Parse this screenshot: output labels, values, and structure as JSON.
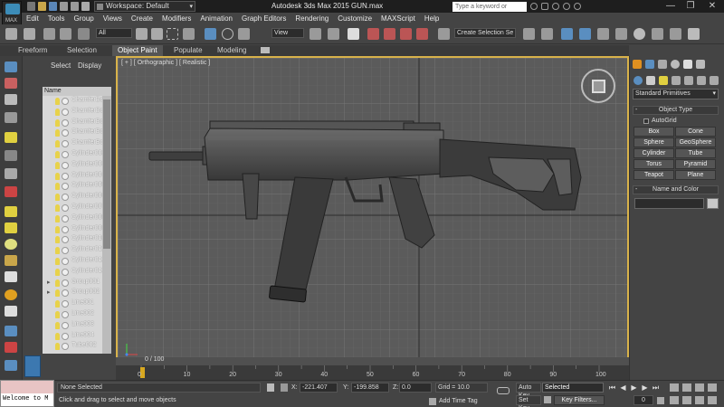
{
  "app": {
    "title": "Autodesk 3ds Max  2015    GUN.max",
    "workspace": "Workspace: Default",
    "logo_text": "MAX",
    "search_placeholder": "Type a keyword or phrase"
  },
  "window_controls": {
    "minimize": "—",
    "maximize": "❐",
    "close": "✕"
  },
  "menu": [
    "Edit",
    "Tools",
    "Group",
    "Views",
    "Create",
    "Modifiers",
    "Animation",
    "Graph Editors",
    "Rendering",
    "Customize",
    "MAXScript",
    "Help"
  ],
  "toolbar": {
    "selection_filter": "All",
    "ref_coord": "View",
    "named_selection": "Create Selection Se"
  },
  "ribbon": {
    "tabs": [
      "Freeform",
      "Selection",
      "Object Paint",
      "Populate",
      "Modeling"
    ],
    "active_tab": "Object Paint"
  },
  "explorer": {
    "tabs": [
      "Select",
      "Display"
    ],
    "column_header": "Name",
    "items": [
      {
        "label": "ChamferBo",
        "group": false
      },
      {
        "label": "ChamferBo",
        "group": false
      },
      {
        "label": "ChamferBo",
        "group": false
      },
      {
        "label": "ChamferBo",
        "group": false
      },
      {
        "label": "ChamferBo",
        "group": false
      },
      {
        "label": "Cylinder002",
        "group": false
      },
      {
        "label": "Cylinder003",
        "group": false
      },
      {
        "label": "Cylinder004",
        "group": false
      },
      {
        "label": "Cylinder005",
        "group": false
      },
      {
        "label": "Cylinder006",
        "group": false
      },
      {
        "label": "Cylinder007",
        "group": false
      },
      {
        "label": "Cylinder008",
        "group": false
      },
      {
        "label": "Cylinder009",
        "group": false
      },
      {
        "label": "Cylinder010",
        "group": false
      },
      {
        "label": "Cylinder011",
        "group": false
      },
      {
        "label": "Cylinder012",
        "group": false
      },
      {
        "label": "Cylinder013",
        "group": false
      },
      {
        "label": "Group001",
        "group": true
      },
      {
        "label": "Group002",
        "group": true
      },
      {
        "label": "Line001",
        "group": false
      },
      {
        "label": "Line002",
        "group": false
      },
      {
        "label": "Line003",
        "group": false
      },
      {
        "label": "Line004",
        "group": false
      },
      {
        "label": "Tube002",
        "group": false
      }
    ]
  },
  "viewport": {
    "label": "[ + ] [ Orthographic ] [ Realistic ]"
  },
  "command_panel": {
    "category_dropdown": "Standard Primitives",
    "object_type_title": "Object Type",
    "autogrid": "AutoGrid",
    "buttons": [
      "Box",
      "Cone",
      "Sphere",
      "GeoSphere",
      "Cylinder",
      "Tube",
      "Torus",
      "Pyramid",
      "Teapot",
      "Plane"
    ],
    "name_color_title": "Name and Color"
  },
  "timeline": {
    "frame_label": "0 / 100",
    "ticks": [
      "0",
      "10",
      "20",
      "30",
      "40",
      "50",
      "60",
      "70",
      "80",
      "90",
      "100"
    ]
  },
  "status": {
    "maxscript_text": "Welcome to M",
    "selection": "None Selected",
    "hint": "Click and drag to select and move objects",
    "x_label": "X:",
    "x_value": "-221.407",
    "y_label": "Y:",
    "y_value": "-199.858",
    "z_label": "Z:",
    "z_value": "0.0",
    "grid": "Grid = 10.0",
    "add_time_tag": "Add Time Tag",
    "auto_key": "Auto Key",
    "set_key": "Set Key",
    "key_mode": "Selected",
    "key_filters": "Key Filters...",
    "current_frame": "0"
  }
}
